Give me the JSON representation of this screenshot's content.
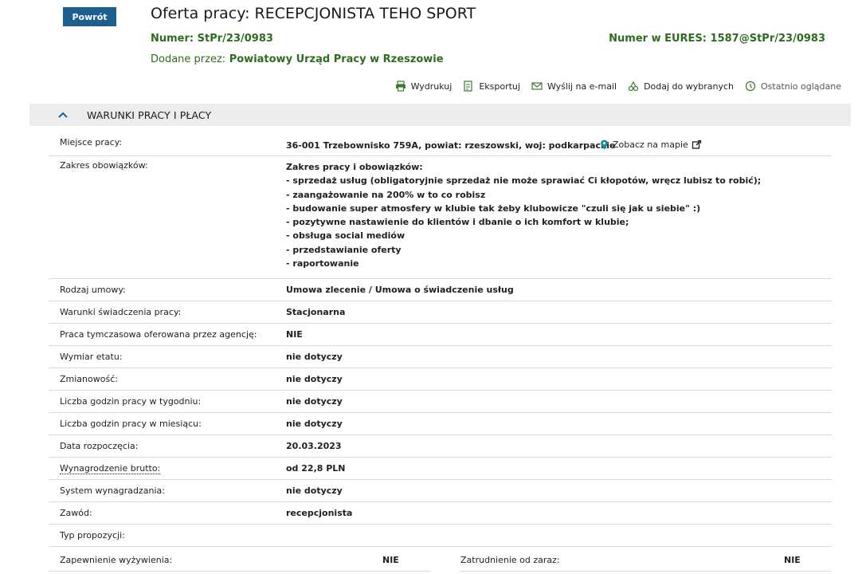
{
  "back_button": "Powrót",
  "title": "Oferta pracy: RECEPCJONISTA TEHO SPORT",
  "number_label": "Numer:",
  "number_value": "StPr/23/0983",
  "eures_label": "Numer w EURES:",
  "eures_value": "1587@StPr/23/0983",
  "added_label": "Dodane przez:",
  "added_value": "Powiatowy Urząd Pracy w Rzeszowie",
  "toolbar": {
    "print": "Wydrukuj",
    "export": "Eksportuj",
    "email": "Wyślij na e-mail",
    "favorites": "Dodaj do wybranych",
    "recent": "Ostatnio oglądane"
  },
  "section_title": "WARUNKI PRACY I PŁACY",
  "workplace": {
    "label": "Miejsce pracy:",
    "value": "36-001 Trzebownisko 759A, powiat: rzeszowski, woj: podkarpackie",
    "map_link": "Zobacz na mapie"
  },
  "duties": {
    "label": "Zakres obowiązków:",
    "lines": [
      "Zakres pracy i obowiązków:",
      "- sprzedaż usług (obligatoryjnie sprzedaż nie może sprawiać Ci kłopotów, wręcz lubisz to robić);",
      "- zaangażowanie na 200% w to co robisz",
      "- budowanie super atmosfery w klubie tak żeby klubowicze \"czuli się jak u siebie\" :)",
      "- pozytywne nastawienie do klientów i dbanie o ich komfort w klubie;",
      "- obsługa social mediów",
      "- przedstawianie oferty",
      "- raportowanie"
    ]
  },
  "rows": [
    {
      "label": "Rodzaj umowy:",
      "value": "Umowa zlecenie / Umowa o świadczenie usług"
    },
    {
      "label": "Warunki świadczenia pracy:",
      "value": "Stacjonarna"
    },
    {
      "label": "Praca tymczasowa oferowana przez agencję:",
      "value": "NIE"
    },
    {
      "label": "Wymiar etatu:",
      "value": "nie dotyczy"
    },
    {
      "label": "Zmianowość:",
      "value": "nie dotyczy"
    },
    {
      "label": "Liczba godzin pracy w tygodniu:",
      "value": "nie dotyczy"
    },
    {
      "label": "Liczba godzin pracy w miesiącu:",
      "value": "nie dotyczy"
    },
    {
      "label": "Data rozpoczęcia:",
      "value": "20.03.2023"
    },
    {
      "label": "Wynagrodzenie brutto:",
      "value": "od 22,8 PLN"
    },
    {
      "label": "System wynagradzania:",
      "value": "nie dotyczy"
    },
    {
      "label": "Zawód:",
      "value": "recepcjonista"
    },
    {
      "label": "Typ propozycji:",
      "value": ""
    }
  ],
  "split": {
    "left_label": "Zapewnienie wyżywienia:",
    "left_value": "NIE",
    "right_label": "Zatrudnienie od zaraz:",
    "right_value": "NIE"
  },
  "colors": {
    "button": "#1b5e8f",
    "meta_green": "#2f6b1f",
    "icon_green": "#3a7a2a",
    "section_bg": "#ececec",
    "map_pin": "#1b8fa0"
  }
}
